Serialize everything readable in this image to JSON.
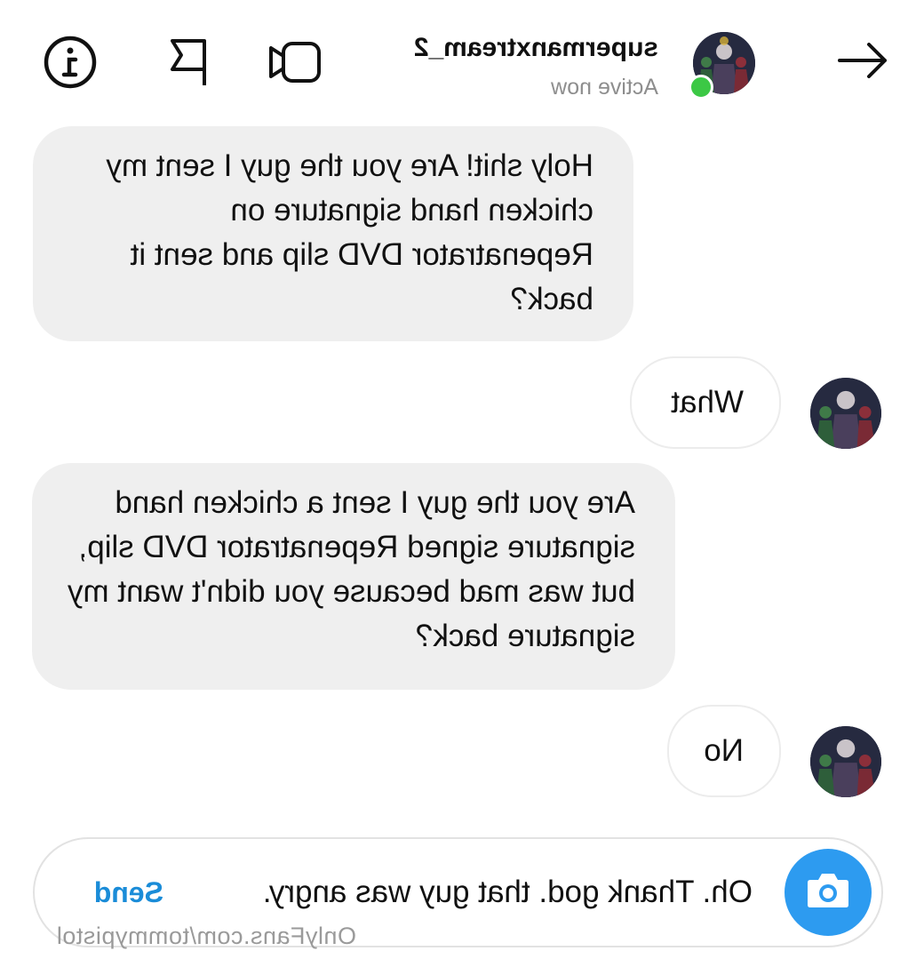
{
  "header": {
    "username": "supermanxtream_2",
    "status": "Active now",
    "icons": {
      "back": "arrow-left-icon",
      "video": "video-camera-icon",
      "flag": "flag-icon",
      "info": "info-icon"
    },
    "status_dot_color": "#3cc845"
  },
  "messages": [
    {
      "direction": "incoming",
      "text": "Holy shit! Are you the guy I sent my chicken hand signature on Repenatrator DVD slip and sent it back?"
    },
    {
      "direction": "outgoing",
      "text": "What"
    },
    {
      "direction": "incoming",
      "text": "Are you the guy I sent a chicken hand signature signed Repenatrator DVD slip, but was mad because you didn't want my signature back?"
    },
    {
      "direction": "outgoing",
      "text": "No"
    }
  ],
  "composer": {
    "value": "Oh. Thank god. that guy was angry.",
    "send_label": "Send",
    "camera_icon": "camera-icon",
    "accent_color": "#2d9bf0"
  },
  "watermark": "OnlyFans.com/tommypistol"
}
